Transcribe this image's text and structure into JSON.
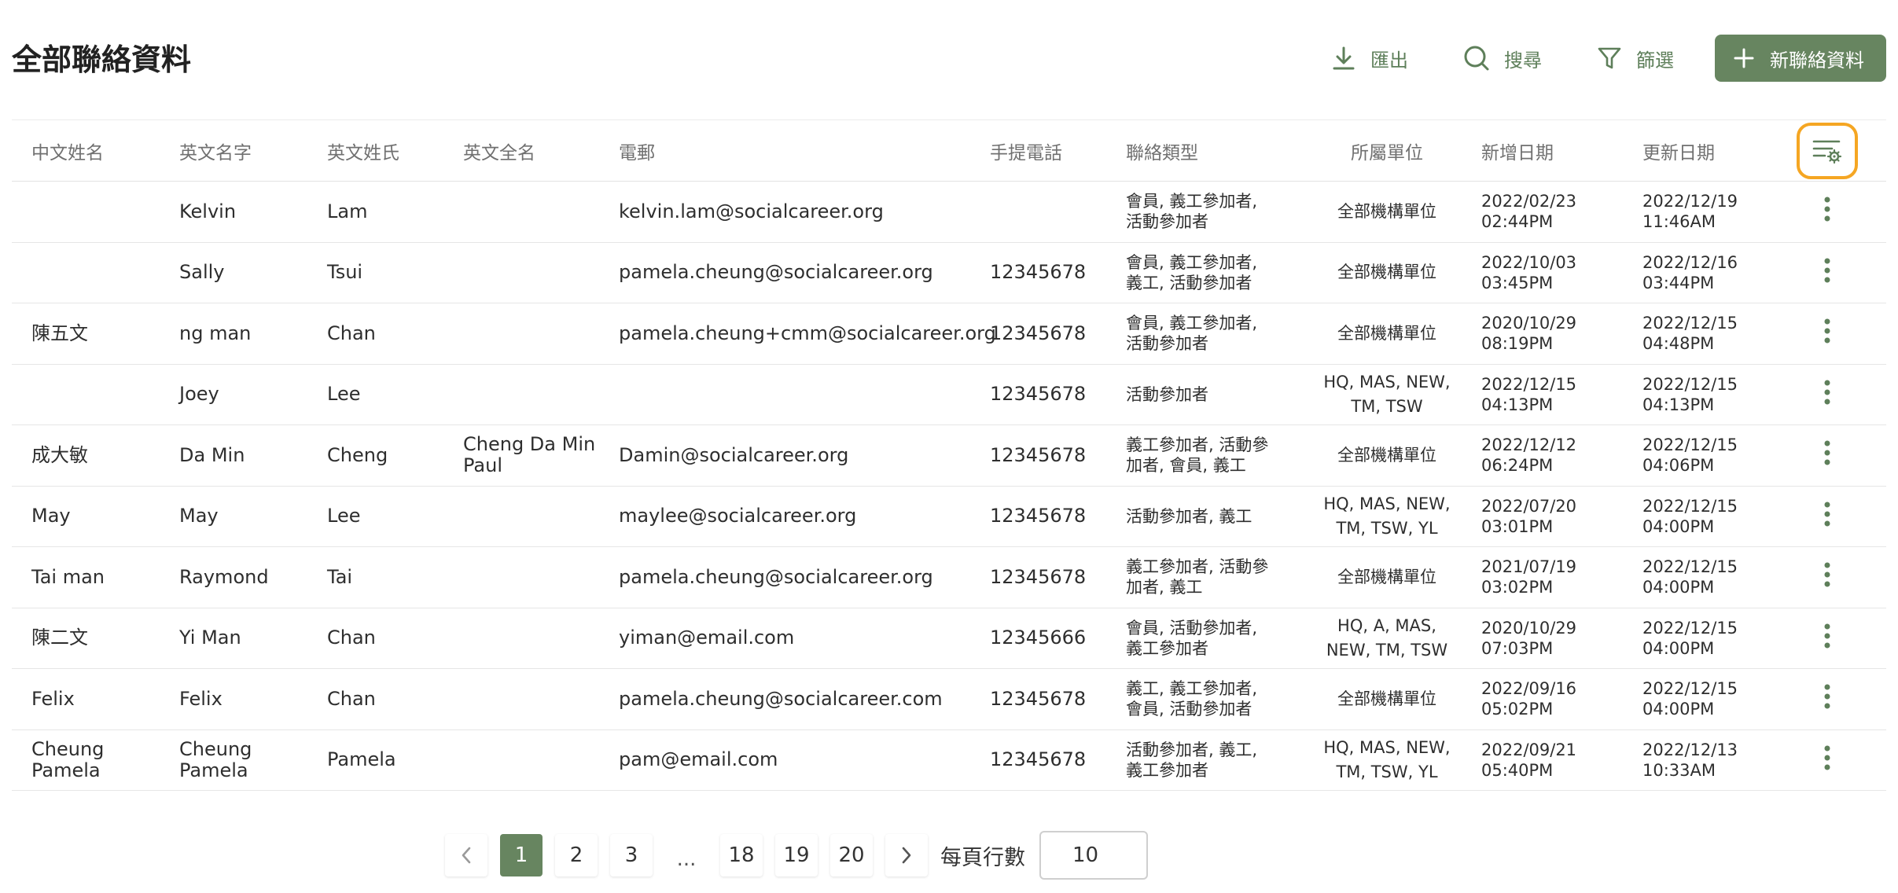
{
  "page": {
    "title": "全部聯絡資料"
  },
  "toolbar": {
    "export_label": "匯出",
    "search_label": "搜尋",
    "filter_label": "篩選",
    "new_contact_label": "新聯絡資料"
  },
  "colors": {
    "accent": "#678560",
    "highlight": "#f5a623"
  },
  "table": {
    "headers": {
      "chinese_name": "中文姓名",
      "first_name": "英文名字",
      "last_name": "英文姓氏",
      "full_name": "英文全名",
      "email": "電郵",
      "mobile": "手提電話",
      "contact_type": "聯絡類型",
      "unit": "所屬單位",
      "created": "新增日期",
      "updated": "更新日期"
    },
    "rows": [
      {
        "chinese_name": "",
        "first_name": "Kelvin",
        "last_name": "Lam",
        "full_name": "",
        "email": "kelvin.lam@socialcareer.org",
        "mobile": "",
        "type_1": "會員, 義工參加者,",
        "type_2": "活動參加者",
        "unit_1": "全部機構單位",
        "unit_2": "",
        "created_date": "2022/02/23",
        "created_time": "02:44PM",
        "updated_date": "2022/12/19",
        "updated_time": "11:46AM"
      },
      {
        "chinese_name": "",
        "first_name": "Sally",
        "last_name": "Tsui",
        "full_name": "",
        "email": "pamela.cheung@socialcareer.org",
        "mobile": "12345678",
        "type_1": "會員, 義工參加者,",
        "type_2": "義工, 活動參加者",
        "unit_1": "全部機構單位",
        "unit_2": "",
        "created_date": "2022/10/03",
        "created_time": "03:45PM",
        "updated_date": "2022/12/16",
        "updated_time": "03:44PM"
      },
      {
        "chinese_name": "陳五文",
        "first_name": "ng man",
        "last_name": "Chan",
        "full_name": "",
        "email": "pamela.cheung+cmm@socialcareer.org",
        "mobile": "12345678",
        "type_1": "會員, 義工參加者,",
        "type_2": "活動參加者",
        "unit_1": "全部機構單位",
        "unit_2": "",
        "created_date": "2020/10/29",
        "created_time": "08:19PM",
        "updated_date": "2022/12/15",
        "updated_time": "04:48PM"
      },
      {
        "chinese_name": "",
        "first_name": "Joey",
        "last_name": "Lee",
        "full_name": "",
        "email": "",
        "mobile": "12345678",
        "type_1": "活動參加者",
        "type_2": "",
        "unit_1": "HQ, MAS, NEW,",
        "unit_2": "TM, TSW",
        "created_date": "2022/12/15",
        "created_time": "04:13PM",
        "updated_date": "2022/12/15",
        "updated_time": "04:13PM"
      },
      {
        "chinese_name": "成大敏",
        "first_name": "Da Min",
        "last_name": "Cheng",
        "full_name_1": "Cheng Da Min",
        "full_name_2": "Paul",
        "email": "Damin@socialcareer.org",
        "mobile": "12345678",
        "type_1": "義工參加者, 活動參",
        "type_2": "加者, 會員, 義工",
        "unit_1": "全部機構單位",
        "unit_2": "",
        "created_date": "2022/12/12",
        "created_time": "06:24PM",
        "updated_date": "2022/12/15",
        "updated_time": "04:06PM"
      },
      {
        "chinese_name": "May",
        "first_name": "May",
        "last_name": "Lee",
        "full_name": "",
        "email": "maylee@socialcareer.org",
        "mobile": "12345678",
        "type_1": "活動參加者, 義工",
        "type_2": "",
        "unit_1": "HQ, MAS, NEW,",
        "unit_2": "TM, TSW, YL",
        "created_date": "2022/07/20",
        "created_time": "03:01PM",
        "updated_date": "2022/12/15",
        "updated_time": "04:00PM"
      },
      {
        "chinese_name": "Tai man",
        "first_name": "Raymond",
        "last_name": "Tai",
        "full_name": "",
        "email": "pamela.cheung@socialcareer.org",
        "mobile": "12345678",
        "type_1": "義工參加者, 活動參",
        "type_2": "加者, 義工",
        "unit_1": "全部機構單位",
        "unit_2": "",
        "created_date": "2021/07/19",
        "created_time": "03:02PM",
        "updated_date": "2022/12/15",
        "updated_time": "04:00PM"
      },
      {
        "chinese_name": "陳二文",
        "first_name": "Yi Man",
        "last_name": "Chan",
        "full_name": "",
        "email": "yiman@email.com",
        "mobile": "12345666",
        "type_1": "會員, 活動參加者,",
        "type_2": "義工參加者",
        "unit_1": "HQ, A, MAS,",
        "unit_2": "NEW, TM, TSW",
        "created_date": "2020/10/29",
        "created_time": "07:03PM",
        "updated_date": "2022/12/15",
        "updated_time": "04:00PM"
      },
      {
        "chinese_name": "Felix",
        "first_name": "Felix",
        "last_name": "Chan",
        "full_name": "",
        "email": "pamela.cheung@socialcareer.com",
        "mobile": "12345678",
        "type_1": "義工, 義工參加者,",
        "type_2": "會員, 活動參加者",
        "unit_1": "全部機構單位",
        "unit_2": "",
        "created_date": "2022/09/16",
        "created_time": "05:02PM",
        "updated_date": "2022/12/15",
        "updated_time": "04:00PM"
      },
      {
        "chinese_name_1": "Cheung",
        "chinese_name_2": "Pamela",
        "first_name_1": "Cheung",
        "first_name_2": "Pamela",
        "last_name": "Pamela",
        "full_name": "",
        "email": "pam@email.com",
        "mobile": "12345678",
        "type_1": "活動參加者, 義工,",
        "type_2": "義工參加者",
        "unit_1": "HQ, MAS, NEW,",
        "unit_2": "TM, TSW, YL",
        "created_date": "2022/09/21",
        "created_time": "05:40PM",
        "updated_date": "2022/12/13",
        "updated_time": "10:33AM"
      }
    ]
  },
  "pagination": {
    "pages": [
      "1",
      "2",
      "3"
    ],
    "ellipsis": "...",
    "tail_pages": [
      "18",
      "19",
      "20"
    ],
    "current_page": "1",
    "per_page_label": "每頁行數",
    "per_page_value": "10"
  }
}
